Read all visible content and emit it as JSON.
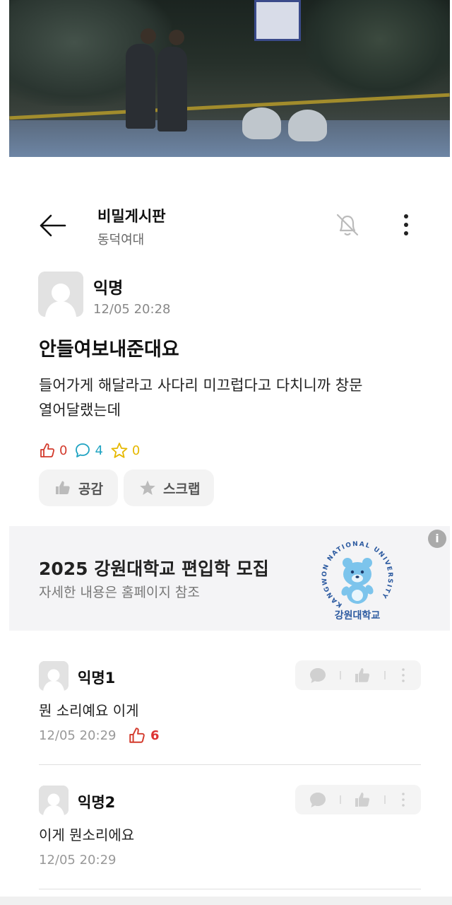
{
  "header": {
    "title": "비밀게시판",
    "subtitle": "동덕여대"
  },
  "post": {
    "author": "익명",
    "time": "12/05 20:28",
    "title": "안들여보내준대요",
    "body_lines": [
      "들어가게 해달라고 사다리 미끄럽다고 다치니까 창문",
      "열어달랬는데"
    ],
    "stats": {
      "likes": "0",
      "comments": "4",
      "scraps": "0"
    },
    "buttons": {
      "like": "공감",
      "scrap": "스크랩"
    }
  },
  "ad": {
    "title": "2025 강원대학교 편입학 모집",
    "subtitle": "자세한 내용은 홈페이지 참조",
    "info": "i",
    "logo_text": "강원대학교",
    "logo_ring_text": "KANGWON NATIONAL UNIVERSITY"
  },
  "comments": [
    {
      "author": "익명1",
      "text": "뭔 소리예요 이게",
      "time": "12/05 20:29",
      "likes": "6"
    },
    {
      "author": "익명2",
      "text": "이게 뭔소리에요",
      "time": "12/05 20:29"
    }
  ],
  "colors": {
    "like": "#d33a2c",
    "comment": "#1fa3c2",
    "scrap": "#e6b800",
    "university_blue": "#2c5aa0"
  },
  "icons": [
    "back-arrow-icon",
    "bell-off-icon",
    "more-vertical-icon",
    "thumbs-up-icon",
    "comment-bubble-icon",
    "star-icon",
    "info-icon"
  ]
}
